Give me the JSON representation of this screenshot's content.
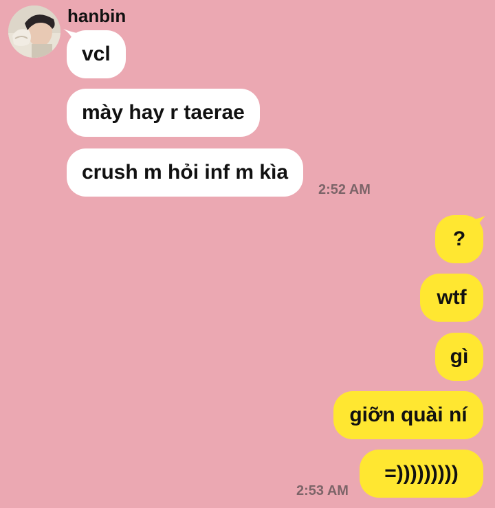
{
  "colors": {
    "background": "#EBA8B2",
    "incoming_bubble": "#FFFFFF",
    "outgoing_bubble": "#FFE731",
    "timestamp": "#7C6468"
  },
  "chat": {
    "sender_name": "hanbin",
    "incoming": [
      {
        "text": "vcl"
      },
      {
        "text": "mày hay r taerae"
      },
      {
        "text": "crush m hỏi inf m kìa"
      }
    ],
    "incoming_time": "2:52 AM",
    "outgoing": [
      {
        "text": "?"
      },
      {
        "text": "wtf"
      },
      {
        "text": "gì"
      },
      {
        "text": "giỡn quài ní"
      },
      {
        "text": "=)))))))))"
      }
    ],
    "outgoing_time": "2:53 AM"
  }
}
